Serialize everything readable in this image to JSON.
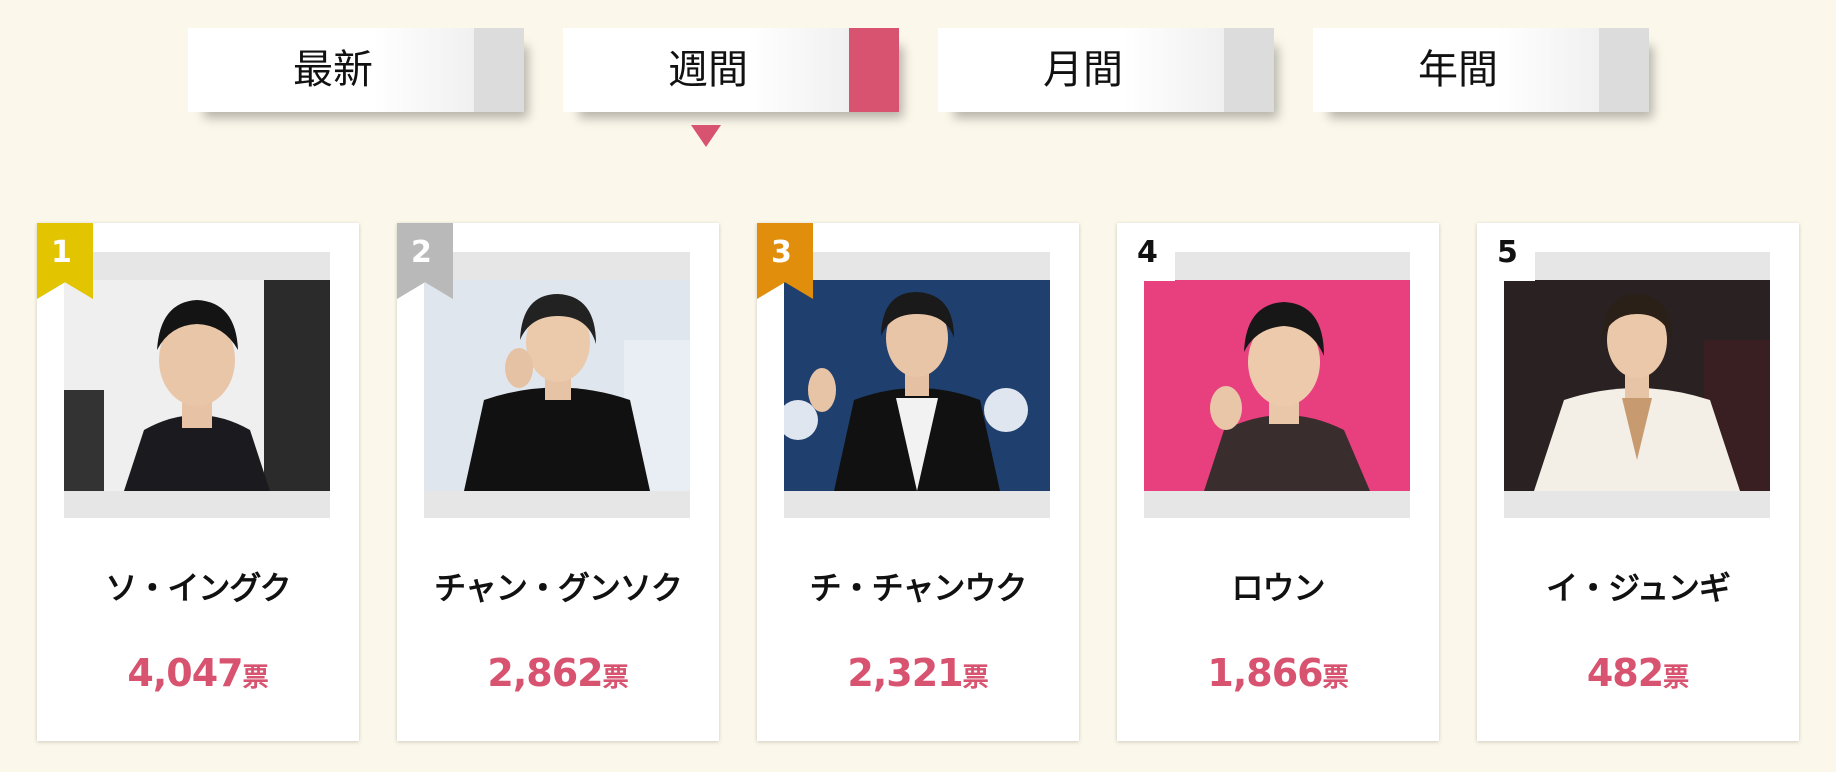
{
  "tabs": [
    {
      "label": "最新",
      "active": false
    },
    {
      "label": "週間",
      "active": true
    },
    {
      "label": "月間",
      "active": false
    },
    {
      "label": "年間",
      "active": false
    }
  ],
  "vote_unit": "票",
  "ranking": [
    {
      "rank": "1",
      "name": "ソ・イングク",
      "votes": "4,047",
      "badge_color": "#e3c400",
      "photo_bg": "#eeeeee"
    },
    {
      "rank": "2",
      "name": "チャン・グンソク",
      "votes": "2,862",
      "badge_color": "#b9b9b9",
      "photo_bg": "#dfe6ee"
    },
    {
      "rank": "3",
      "name": "チ・チャンウク",
      "votes": "2,321",
      "badge_color": "#e08e0b",
      "photo_bg": "#1f3f6e"
    },
    {
      "rank": "4",
      "name": "ロウン",
      "votes": "1,866",
      "badge_color": "",
      "photo_bg": "#e8407f"
    },
    {
      "rank": "5",
      "name": "イ・ジュンギ",
      "votes": "482",
      "badge_color": "",
      "photo_bg": "#2a2222"
    }
  ],
  "colors": {
    "accent": "#d8536f",
    "background": "#fbf7ea"
  }
}
